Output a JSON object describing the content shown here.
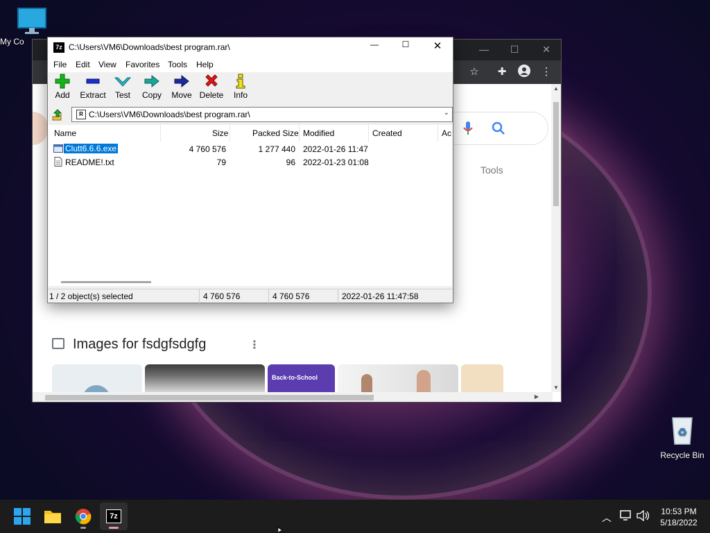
{
  "desktop": {
    "icons": [
      {
        "label": "My Co"
      },
      {
        "label": "Recycle Bin"
      }
    ]
  },
  "chrome": {
    "tools_label": "Tools",
    "images_heading": "Images for fsdgfsdgfg",
    "thumbnail_text": [
      "Back-to-School"
    ]
  },
  "zip": {
    "title": "C:\\Users\\VM6\\Downloads\\best program.rar\\",
    "menu": [
      "File",
      "Edit",
      "View",
      "Favorites",
      "Tools",
      "Help"
    ],
    "toolbar": [
      "Add",
      "Extract",
      "Test",
      "Copy",
      "Move",
      "Delete",
      "Info"
    ],
    "address": "C:\\Users\\VM6\\Downloads\\best program.rar\\",
    "columns": [
      "Name",
      "Size",
      "Packed Size",
      "Modified",
      "Created",
      "Ac"
    ],
    "files": [
      {
        "name": "Clutt6.6.6.exe",
        "size": "4 760 576",
        "packed": "1 277 440",
        "modified": "2022-01-26 11:47",
        "selected": true
      },
      {
        "name": "README!.txt",
        "size": "79",
        "packed": "96",
        "modified": "2022-01-23 01:08",
        "selected": false
      }
    ],
    "status": {
      "selected": "1 / 2 object(s) selected",
      "size": "4 760 576",
      "packed": "4 760 576",
      "modified": "2022-01-26 11:47:58"
    }
  },
  "taskbar": {
    "apps": [
      "start-icon",
      "file-explorer-icon",
      "chrome-icon",
      "7zip-icon"
    ],
    "time": "10:53 PM",
    "date": "5/18/2022"
  },
  "colors": {
    "selection": "#0078d7",
    "taskbar": "#1c1c1c",
    "chrome_dark": "#35363a"
  }
}
